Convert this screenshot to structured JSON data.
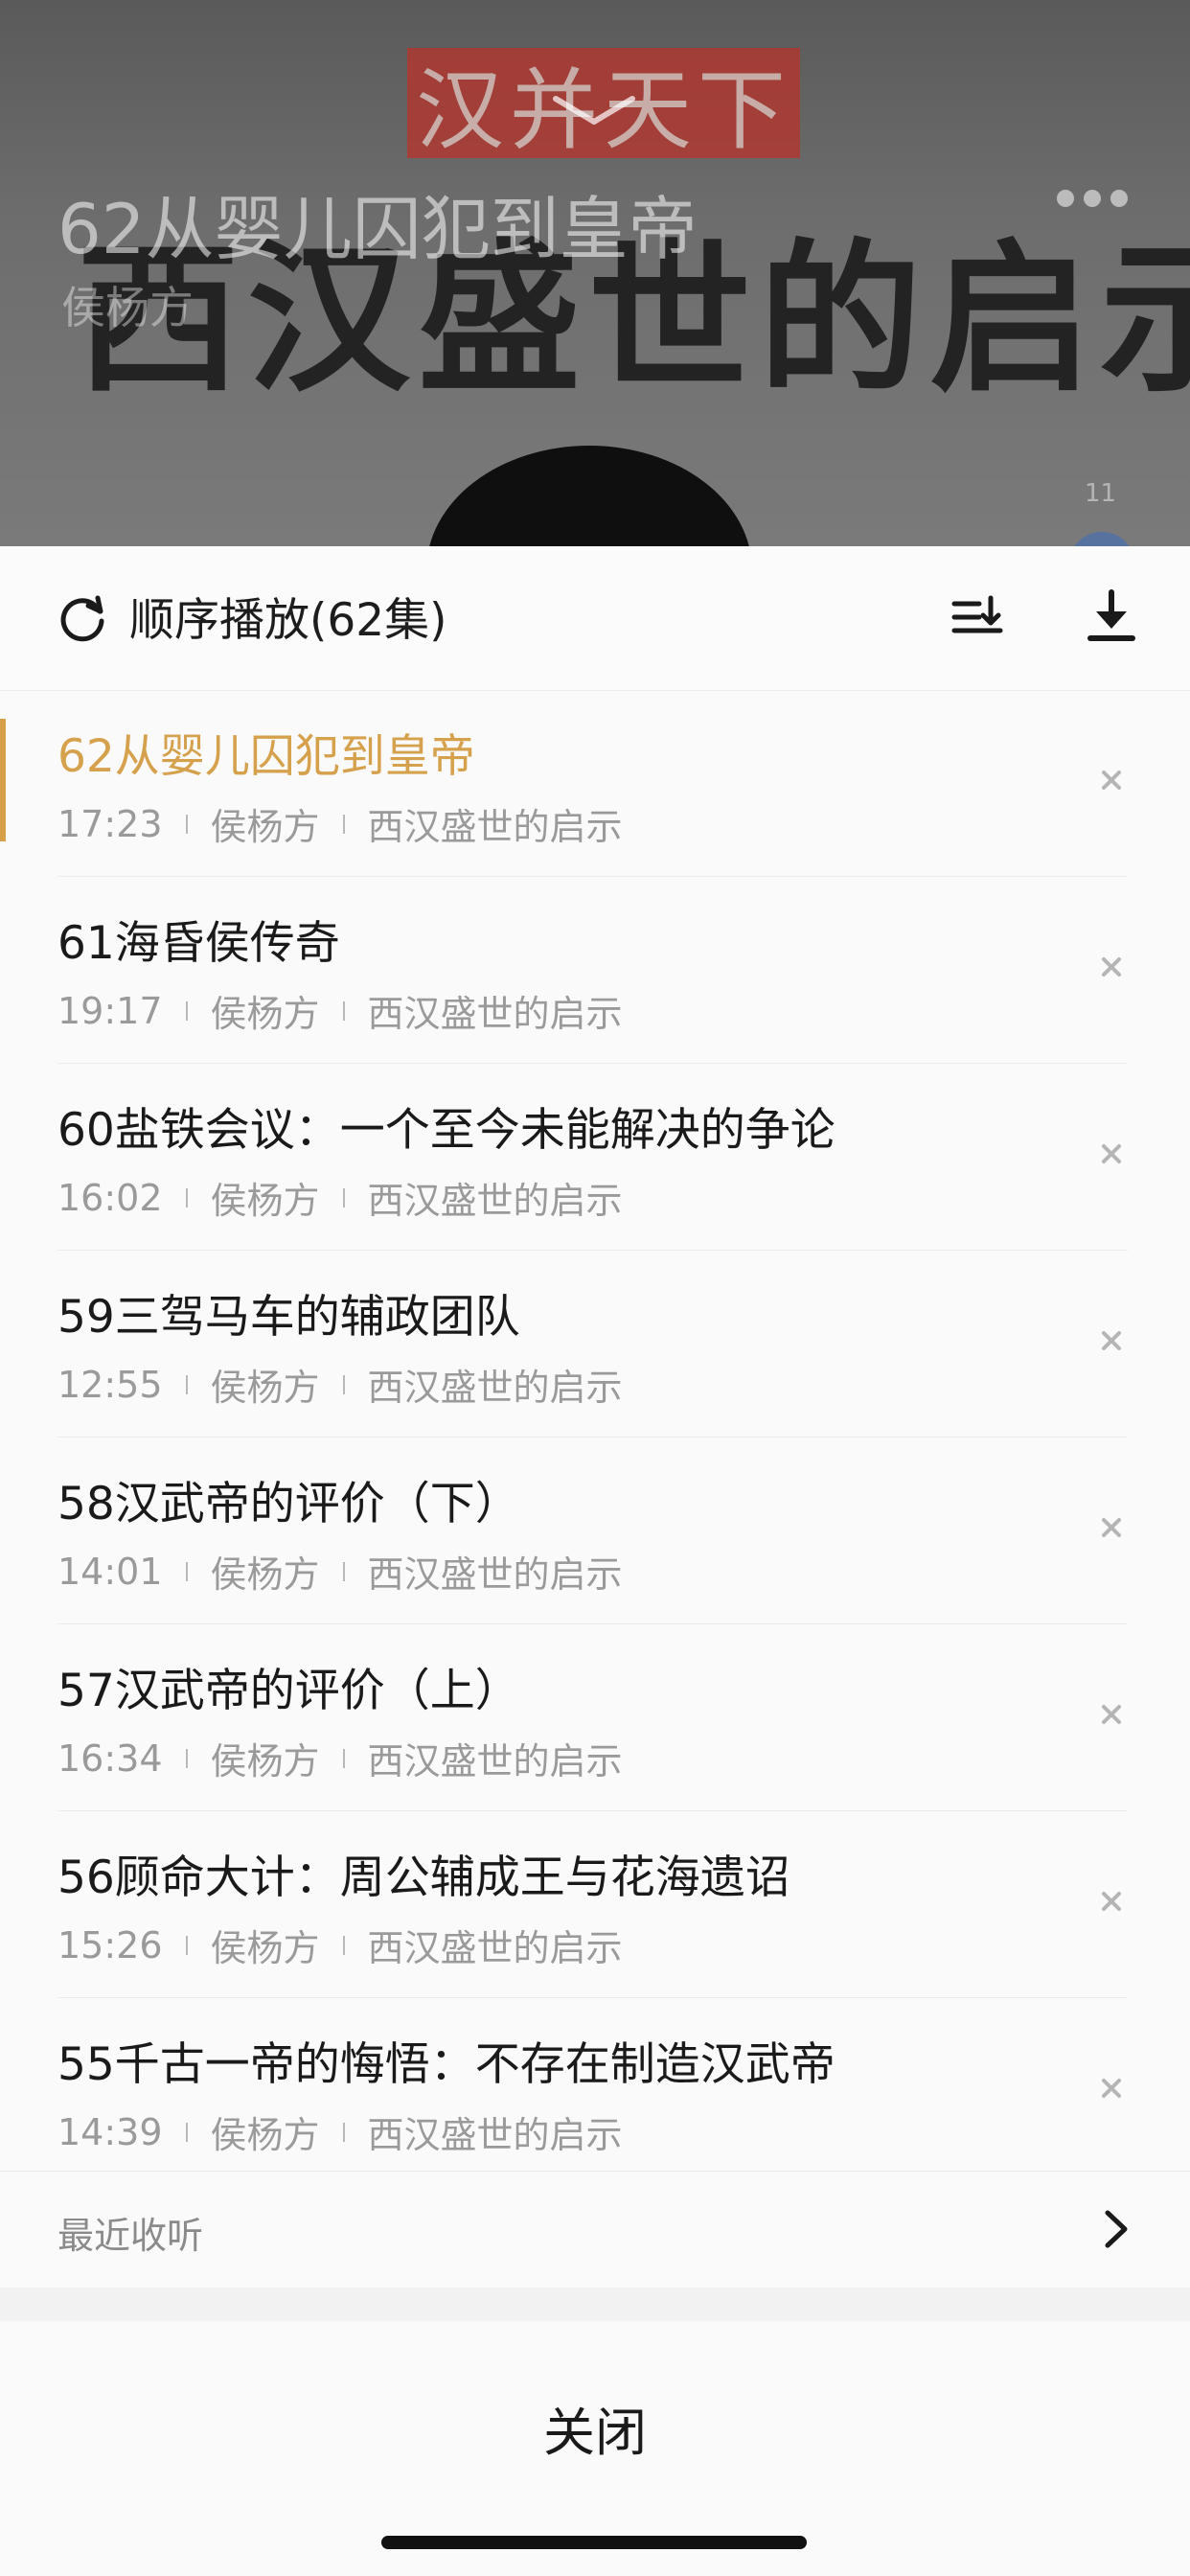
{
  "background": {
    "banner_text": "汉并天下",
    "calligraphy_title": "西汉盛世的启示",
    "episode_title": "62从婴儿囚犯到皇帝",
    "author": "侯杨方",
    "small_number": "11"
  },
  "header": {
    "mode_label": "顺序播放(62集)",
    "icons": [
      "repeat-icon",
      "sort-icon",
      "download-icon"
    ]
  },
  "playlist": [
    {
      "title": "62从婴儿囚犯到皇帝",
      "duration": "17:23",
      "author": "侯杨方",
      "album": "西汉盛世的启示",
      "active": true
    },
    {
      "title": "61海昏侯传奇",
      "duration": "19:17",
      "author": "侯杨方",
      "album": "西汉盛世的启示",
      "active": false
    },
    {
      "title": "60盐铁会议：一个至今未能解决的争论",
      "duration": "16:02",
      "author": "侯杨方",
      "album": "西汉盛世的启示",
      "active": false
    },
    {
      "title": "59三驾马车的辅政团队",
      "duration": "12:55",
      "author": "侯杨方",
      "album": "西汉盛世的启示",
      "active": false
    },
    {
      "title": "58汉武帝的评价（下）",
      "duration": "14:01",
      "author": "侯杨方",
      "album": "西汉盛世的启示",
      "active": false
    },
    {
      "title": "57汉武帝的评价（上）",
      "duration": "16:34",
      "author": "侯杨方",
      "album": "西汉盛世的启示",
      "active": false
    },
    {
      "title": "56顾命大计：周公辅成王与花海遗诏",
      "duration": "15:26",
      "author": "侯杨方",
      "album": "西汉盛世的启示",
      "active": false
    },
    {
      "title": "55千古一帝的悔悟：不存在制造汉武帝",
      "duration": "14:39",
      "author": "侯杨方",
      "album": "西汉盛世的启示",
      "active": false
    }
  ],
  "recent": {
    "label": "最近收听"
  },
  "footer": {
    "close_label": "关闭"
  },
  "colors": {
    "accent": "#d6a14d",
    "text": "#1a1a1a",
    "meta": "#9a9a9a"
  }
}
